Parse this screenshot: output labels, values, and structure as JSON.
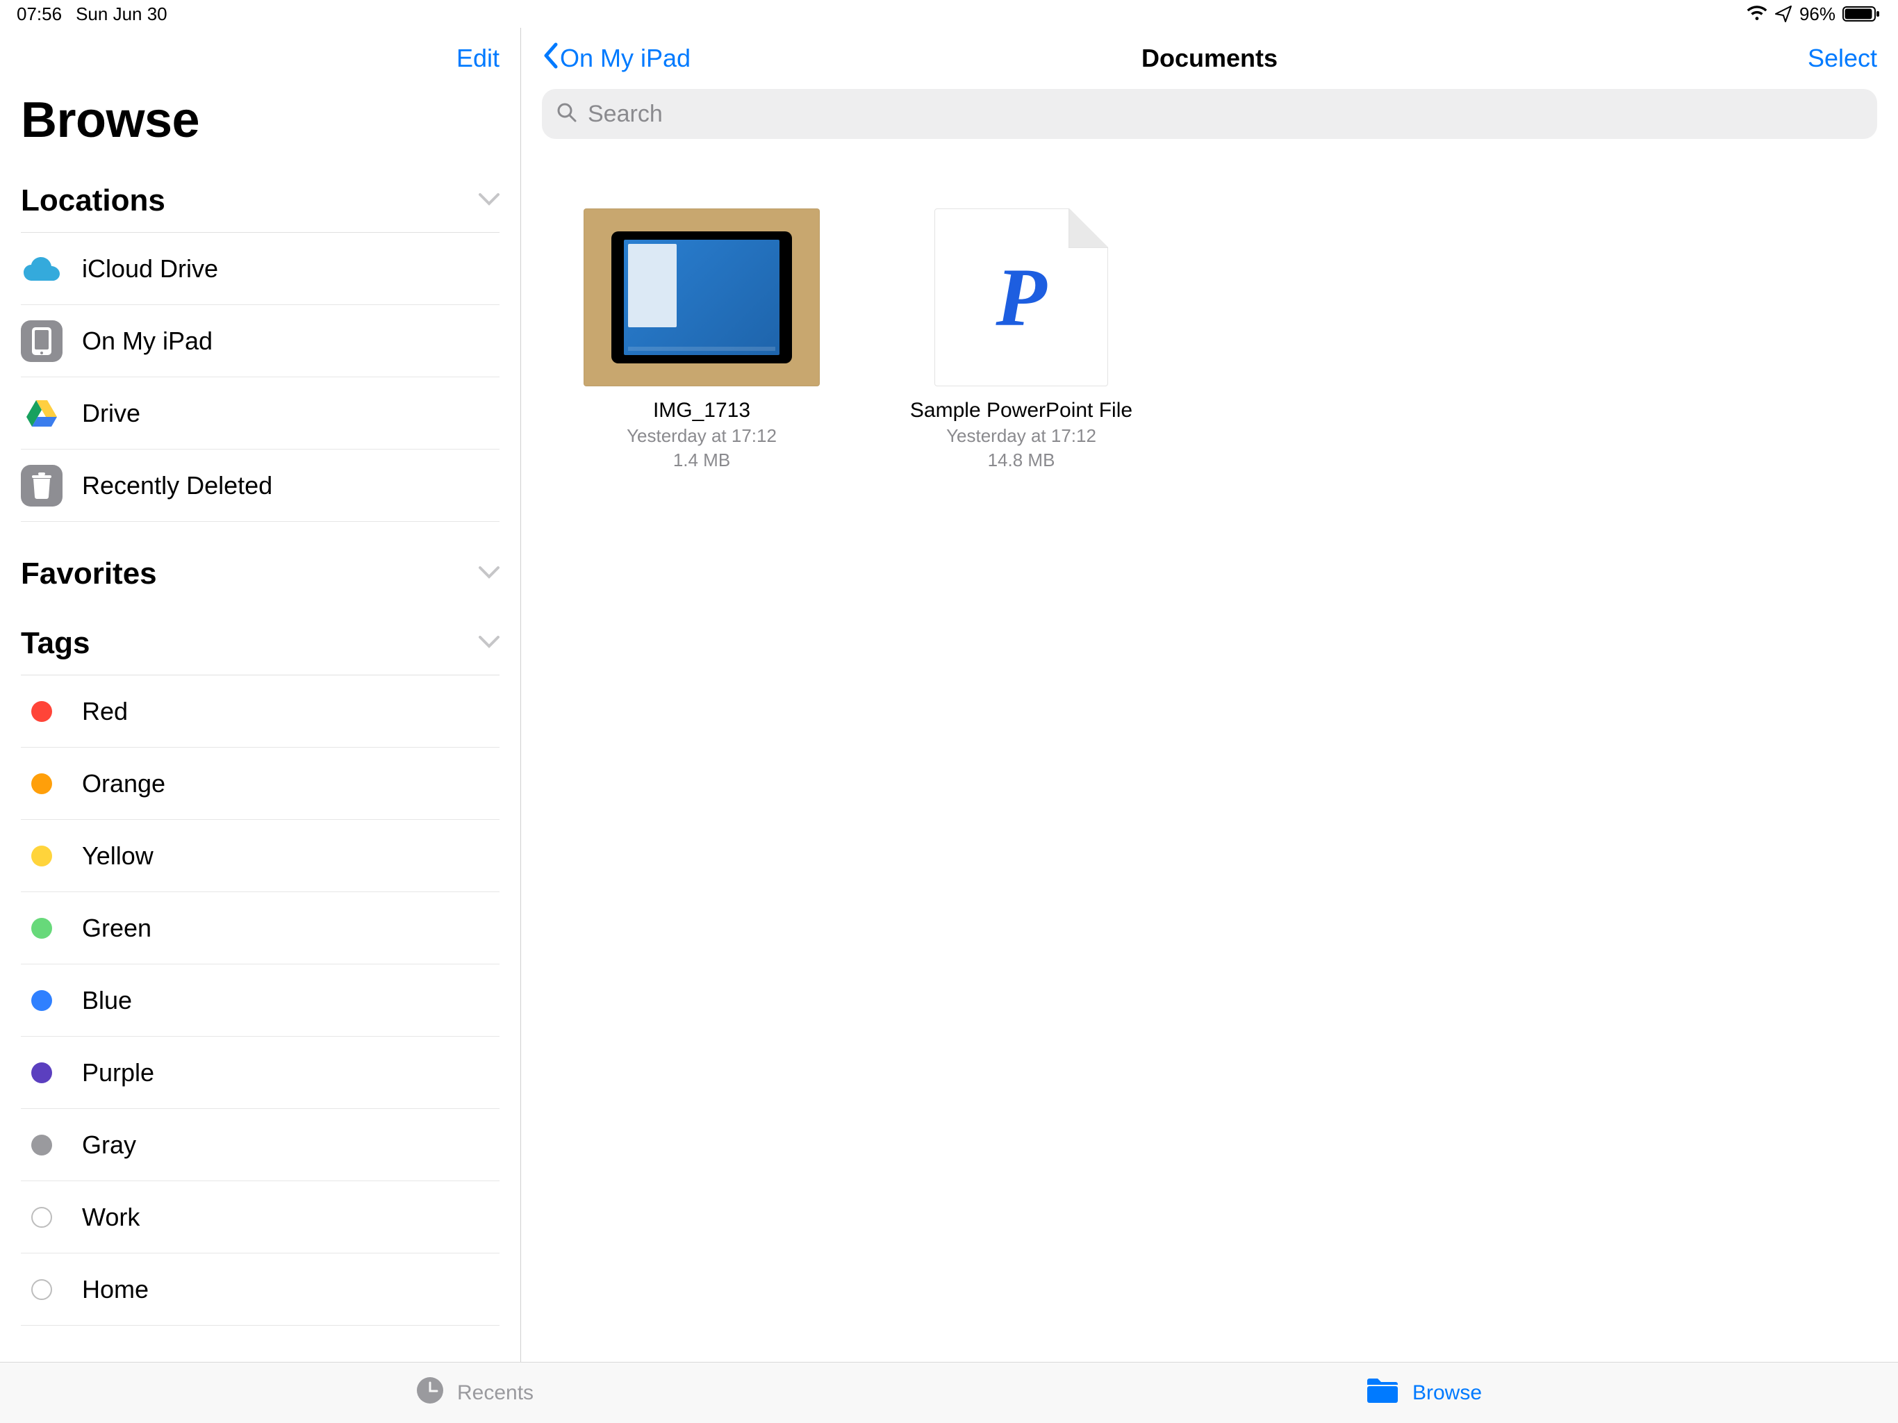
{
  "status": {
    "time": "07:56",
    "date": "Sun Jun 30",
    "battery_pct": "96%"
  },
  "sidebar": {
    "edit_label": "Edit",
    "title": "Browse",
    "sections": {
      "locations": {
        "title": "Locations",
        "items": [
          {
            "label": "iCloud Drive"
          },
          {
            "label": "On My iPad"
          },
          {
            "label": "Drive"
          },
          {
            "label": "Recently Deleted"
          }
        ]
      },
      "favorites": {
        "title": "Favorites"
      },
      "tags": {
        "title": "Tags",
        "items": [
          {
            "label": "Red",
            "color": "#ff4438"
          },
          {
            "label": "Orange",
            "color": "#ff9f0a"
          },
          {
            "label": "Yellow",
            "color": "#ffd43b"
          },
          {
            "label": "Green",
            "color": "#67d97a"
          },
          {
            "label": "Blue",
            "color": "#2f80ff"
          },
          {
            "label": "Purple",
            "color": "#5b3fbf"
          },
          {
            "label": "Gray",
            "color": "#9a9a9e"
          },
          {
            "label": "Work",
            "outline": true
          },
          {
            "label": "Home",
            "outline": true
          }
        ]
      }
    }
  },
  "main": {
    "back_label": "On My iPad",
    "title": "Documents",
    "select_label": "Select",
    "search_placeholder": "Search",
    "files": [
      {
        "name": "IMG_1713",
        "meta1": "Yesterday at 17:12",
        "meta2": "1.4 MB",
        "kind": "photo"
      },
      {
        "name": "Sample PowerPoint File",
        "meta1": "Yesterday at 17:12",
        "meta2": "14.8 MB",
        "kind": "doc"
      }
    ]
  },
  "tabs": {
    "recents": "Recents",
    "browse": "Browse"
  }
}
